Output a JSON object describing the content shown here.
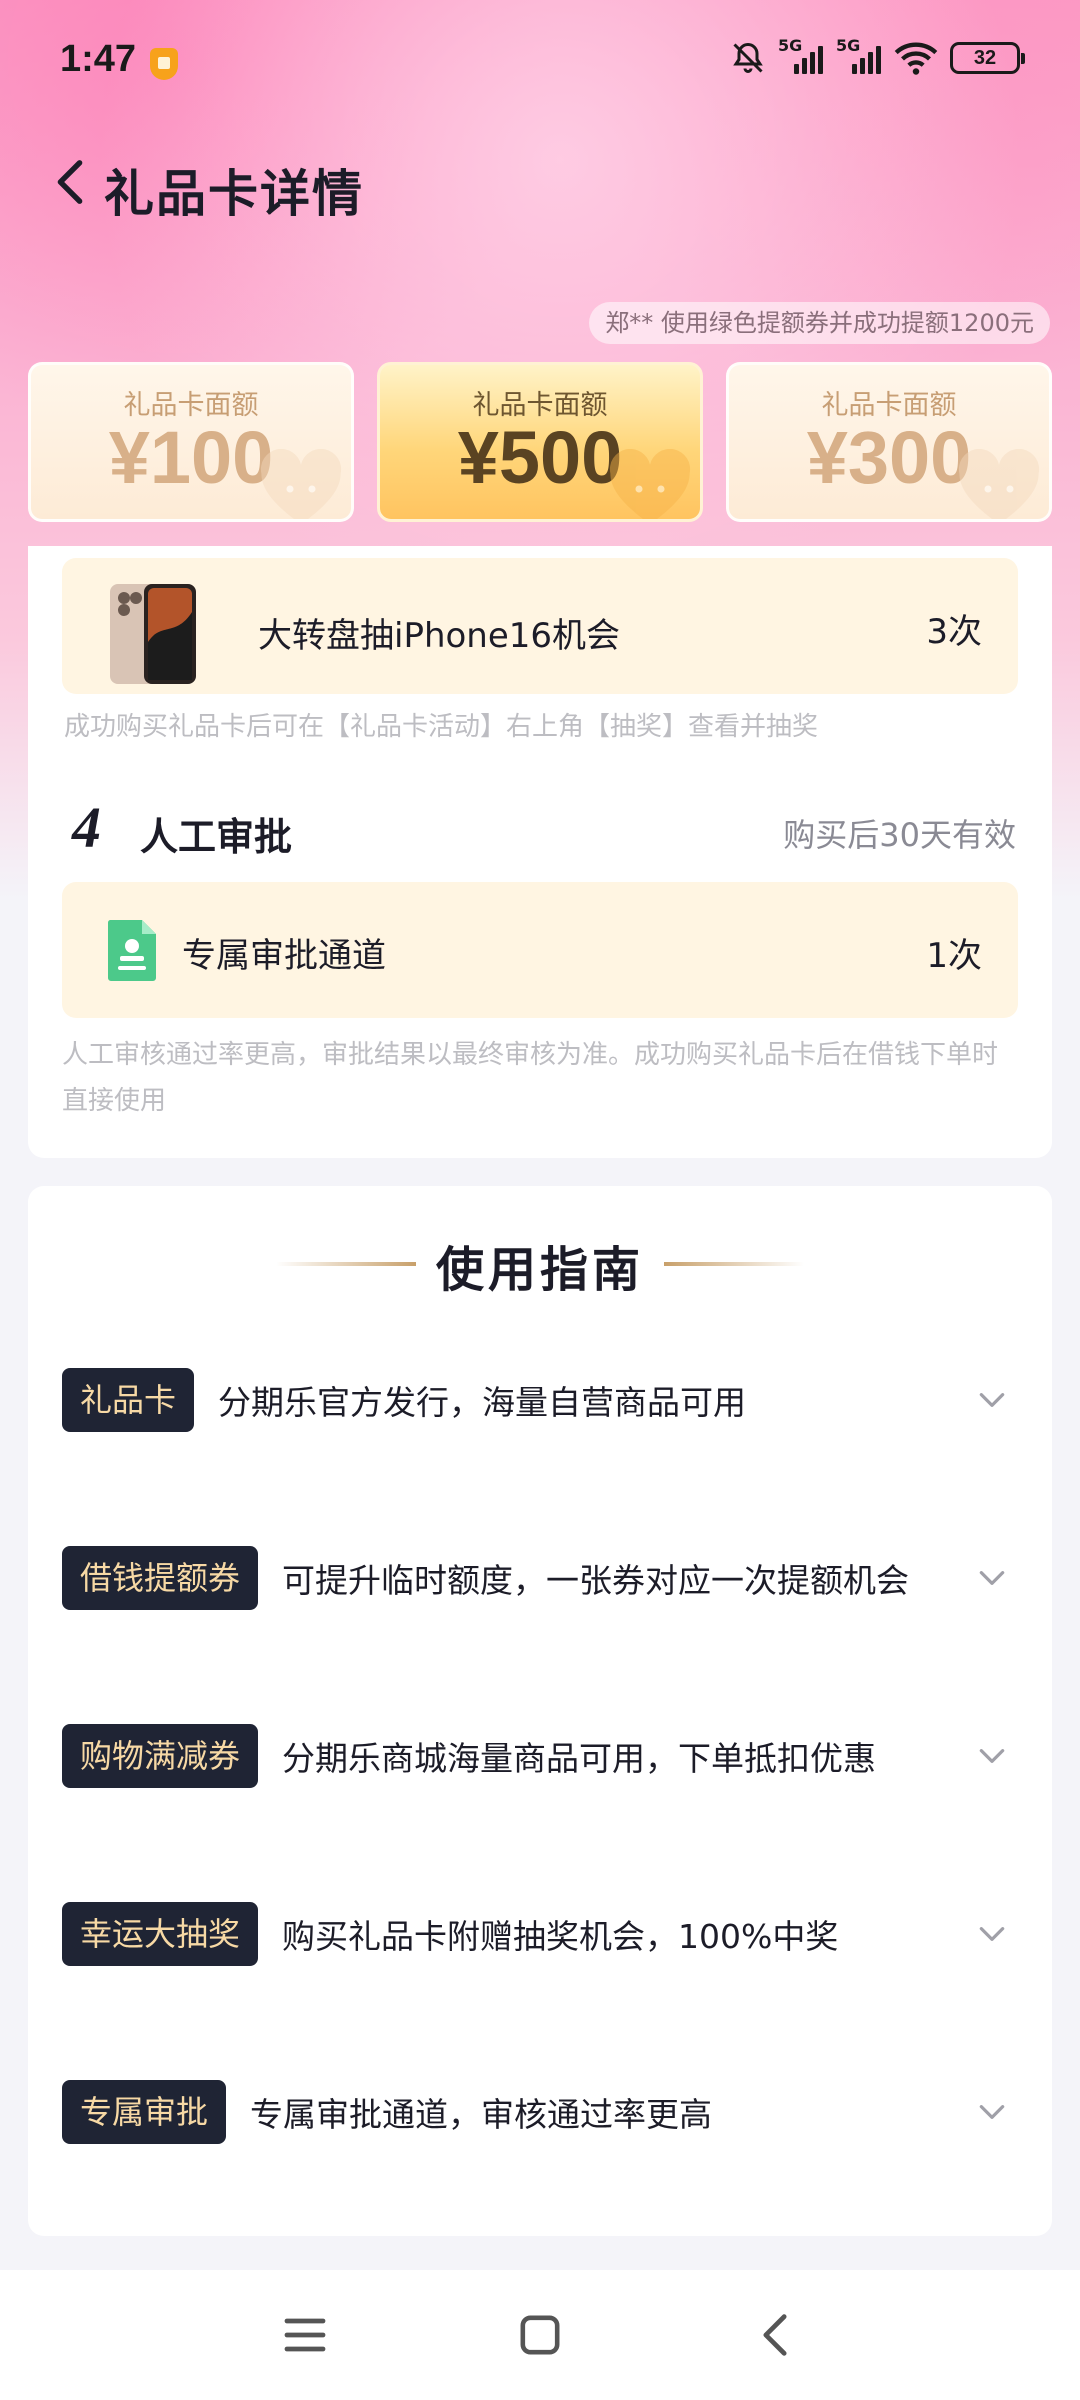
{
  "status_bar": {
    "time": "1:47",
    "network_1": "5G",
    "network_2": "5G",
    "battery": "32"
  },
  "header": {
    "title": "礼品卡详情"
  },
  "ticker": {
    "text": "郑** 使用绿色提额券并成功提额1200元"
  },
  "cards": [
    {
      "label": "礼品卡面额",
      "amount": "¥100",
      "selected": false
    },
    {
      "label": "礼品卡面额",
      "amount": "¥500",
      "selected": true
    },
    {
      "label": "礼品卡面额",
      "amount": "¥300",
      "selected": false
    }
  ],
  "prize": {
    "title": "大转盘抽iPhone16机会",
    "count": "3次",
    "note": "成功购买礼品卡后可在【礼品卡活动】右上角【抽奖】查看并抽奖"
  },
  "section4": {
    "number": "4",
    "title": "人工审批",
    "validity": "购买后30天有效",
    "item_title": "专属审批通道",
    "item_count": "1次",
    "note": "人工审核通过率更高，审批结果以最终审核为准。成功购买礼品卡后在借钱下单时直接使用"
  },
  "guide": {
    "title": "使用指南",
    "items": [
      {
        "tag": "礼品卡",
        "desc": "分期乐官方发行，海量自营商品可用"
      },
      {
        "tag": "借钱提额券",
        "desc": "可提升临时额度，一张券对应一次提额机会"
      },
      {
        "tag": "购物满减券",
        "desc": "分期乐商城海量商品可用，下单抵扣优惠"
      },
      {
        "tag": "幸运大抽奖",
        "desc": "购买礼品卡附赠抽奖机会，100%中奖"
      },
      {
        "tag": "专属审批",
        "desc": "专属审批通道，审核通过率更高"
      }
    ]
  },
  "colors": {
    "accent_gold": "#ffc460",
    "tag_bg": "#1f2434",
    "tag_text": "#f7d9a5",
    "hero_pink": "#fa9ac4"
  }
}
